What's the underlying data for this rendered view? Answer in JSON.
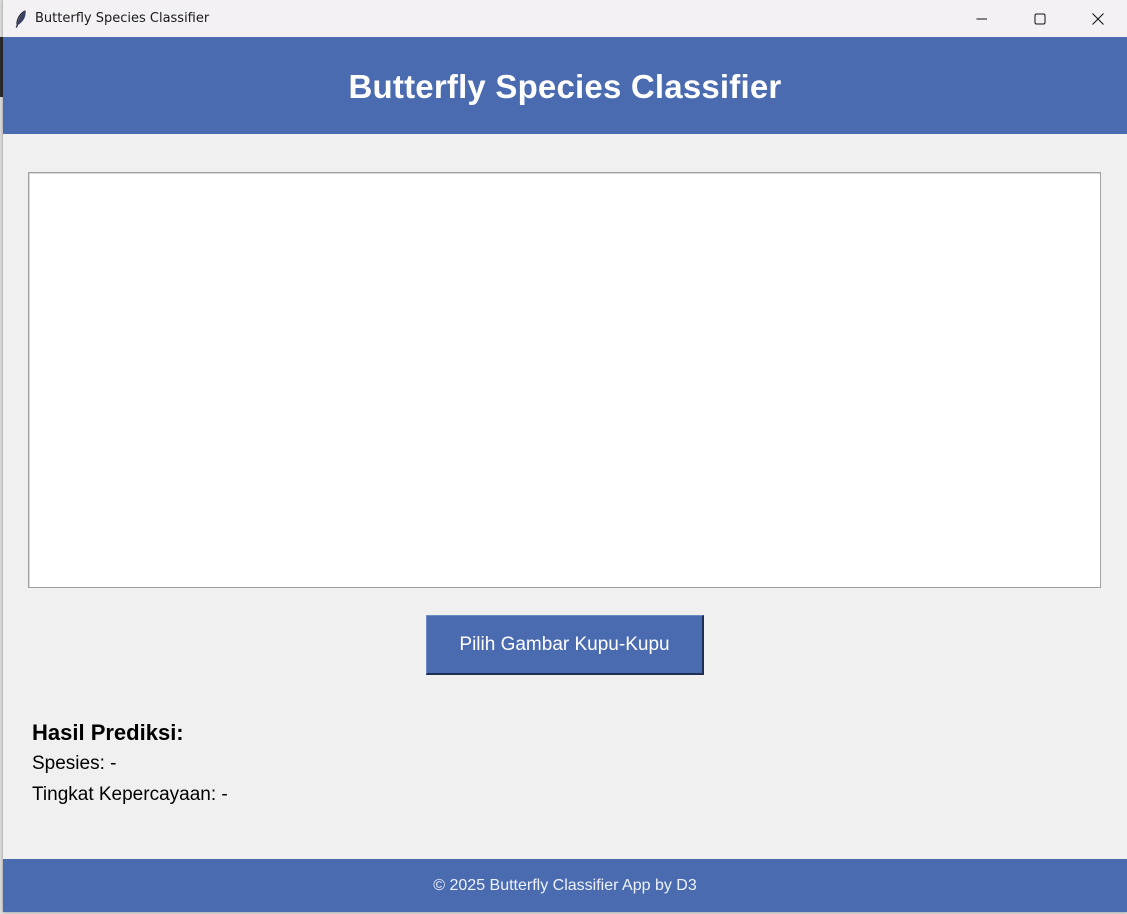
{
  "window": {
    "title": "Butterfly Species Classifier",
    "icon": "feather-icon",
    "controls": [
      "minimize-icon",
      "maximize-icon",
      "close-icon"
    ]
  },
  "header": {
    "title": "Butterfly Species Classifier"
  },
  "image_panel": {
    "content": ""
  },
  "actions": {
    "pick_image_label": "Pilih Gambar Kupu-Kupu"
  },
  "results": {
    "heading": "Hasil Prediksi:",
    "species_line": "Spesies: -",
    "confidence_line": "Tingkat Kepercayaan: -"
  },
  "footer": {
    "text": "© 2025 Butterfly Classifier App by D3"
  },
  "colors": {
    "accent": "#4a6bb0",
    "background": "#f0f0f0",
    "panel": "#ffffff",
    "header_text": "#ffffff"
  }
}
